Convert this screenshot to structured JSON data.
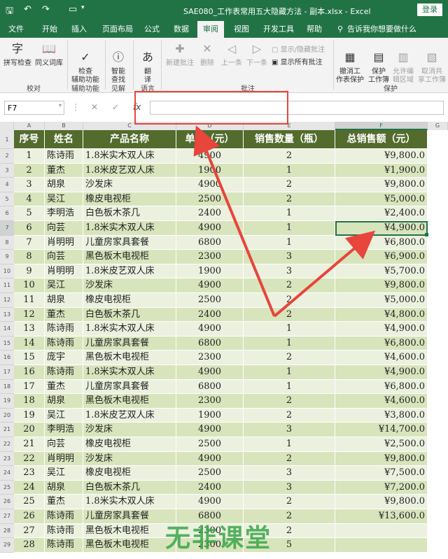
{
  "window": {
    "title": "SAE080_工作表常用五大隐藏方法 - 副本.xlsx  -  Excel",
    "login_label": "登录"
  },
  "tabs": [
    {
      "label": "文件"
    },
    {
      "label": "开始"
    },
    {
      "label": "插入"
    },
    {
      "label": "页面布局"
    },
    {
      "label": "公式"
    },
    {
      "label": "数据"
    },
    {
      "label": "审阅"
    },
    {
      "label": "视图"
    },
    {
      "label": "开发工具"
    },
    {
      "label": "帮助"
    },
    {
      "label": "告诉我你想要做什么"
    }
  ],
  "active_tab": "审阅",
  "ribbon": {
    "spell": "拼写检查",
    "thesaurus": "同义词库",
    "check_access": "检查\n辅助功能",
    "smart_lookup": "智能\n查找",
    "translate": "翻\n译",
    "new_comment": "新建批注",
    "delete": "删除",
    "prev": "上一条",
    "next": "下一条",
    "show_hide_comment": "显示/隐藏批注",
    "show_all_comments": "显示所有批注",
    "unprotect_sheet": "撤消工\n作表保护",
    "protect_workbook": "保护\n工作簿",
    "allow_edit_ranges": "允许编\n辑区域",
    "unshare_workbook": "取消共\n享工作簿",
    "groups": {
      "proofing": "校对",
      "accessibility": "辅助功能",
      "insights": "见解",
      "language": "语言",
      "comments": "批注",
      "protect": "保护"
    }
  },
  "formula_bar": {
    "name_box": "F7",
    "fx": "fx",
    "value": ""
  },
  "columns": [
    "A",
    "B",
    "C",
    "D",
    "E",
    "F",
    "G"
  ],
  "selected_column": "F",
  "selected_row": "7",
  "table": {
    "headers": [
      "序号",
      "姓名",
      "产品名称",
      "单价（元）",
      "销售数量（瓶）",
      "总销售额（元）"
    ],
    "rows": [
      [
        "1",
        "陈诗雨",
        "1.8米实木双人床",
        "4900",
        "2",
        "¥9,800.0"
      ],
      [
        "2",
        "董杰",
        "1.8米皮艺双人床",
        "1900",
        "1",
        "¥1,900.0"
      ],
      [
        "3",
        "胡泉",
        "沙发床",
        "4900",
        "2",
        "¥9,800.0"
      ],
      [
        "4",
        "吴江",
        "橡皮电视柜",
        "2500",
        "2",
        "¥5,000.0"
      ],
      [
        "5",
        "李明浩",
        "白色板木茶几",
        "2400",
        "1",
        "¥2,400.0"
      ],
      [
        "6",
        "向芸",
        "1.8米实木双人床",
        "4900",
        "1",
        "¥4,900.0"
      ],
      [
        "7",
        "肖明明",
        "儿童房家具套餐",
        "6800",
        "1",
        "¥6,800.0"
      ],
      [
        "8",
        "向芸",
        "黑色板木电视柜",
        "2300",
        "3",
        "¥6,900.0"
      ],
      [
        "9",
        "肖明明",
        "1.8米皮艺双人床",
        "1900",
        "3",
        "¥5,700.0"
      ],
      [
        "10",
        "吴江",
        "沙发床",
        "4900",
        "2",
        "¥9,800.0"
      ],
      [
        "11",
        "胡泉",
        "橡皮电视柜",
        "2500",
        "2",
        "¥5,000.0"
      ],
      [
        "12",
        "董杰",
        "白色板木茶几",
        "2400",
        "2",
        "¥4,800.0"
      ],
      [
        "13",
        "陈诗雨",
        "1.8米实木双人床",
        "4900",
        "1",
        "¥4,900.0"
      ],
      [
        "14",
        "陈诗雨",
        "儿童房家具套餐",
        "6800",
        "1",
        "¥6,800.0"
      ],
      [
        "15",
        "庞宇",
        "黑色板木电视柜",
        "2300",
        "2",
        "¥4,600.0"
      ],
      [
        "16",
        "陈诗雨",
        "1.8米实木双人床",
        "4900",
        "1",
        "¥4,900.0"
      ],
      [
        "17",
        "董杰",
        "儿童房家具套餐",
        "6800",
        "1",
        "¥6,800.0"
      ],
      [
        "18",
        "胡泉",
        "黑色板木电视柜",
        "2300",
        "2",
        "¥4,600.0"
      ],
      [
        "19",
        "吴江",
        "1.8米皮艺双人床",
        "1900",
        "2",
        "¥3,800.0"
      ],
      [
        "20",
        "李明浩",
        "沙发床",
        "4900",
        "3",
        "¥14,700.0"
      ],
      [
        "21",
        "向芸",
        "橡皮电视柜",
        "2500",
        "1",
        "¥2,500.0"
      ],
      [
        "22",
        "肖明明",
        "沙发床",
        "4900",
        "2",
        "¥9,800.0"
      ],
      [
        "23",
        "吴江",
        "橡皮电视柜",
        "2500",
        "3",
        "¥7,500.0"
      ],
      [
        "24",
        "胡泉",
        "白色板木茶几",
        "2400",
        "3",
        "¥7,200.0"
      ],
      [
        "25",
        "董杰",
        "1.8米实木双人床",
        "4900",
        "2",
        "¥9,800.0"
      ],
      [
        "26",
        "陈诗雨",
        "儿童房家具套餐",
        "6800",
        "2",
        "¥13,600.0"
      ],
      [
        "27",
        "陈诗雨",
        "黑色板木电视柜",
        "2300",
        "2",
        ""
      ],
      [
        "28",
        "陈诗雨",
        "黑色板木电视柜",
        "2300",
        "5",
        ""
      ]
    ]
  },
  "watermark": "无非课堂",
  "colors": {
    "excel_green": "#217346",
    "header_fill": "#536b2d",
    "row_light": "#ebf1de",
    "row_dark": "#d8e4bc",
    "annotation_red": "#e8453c"
  }
}
